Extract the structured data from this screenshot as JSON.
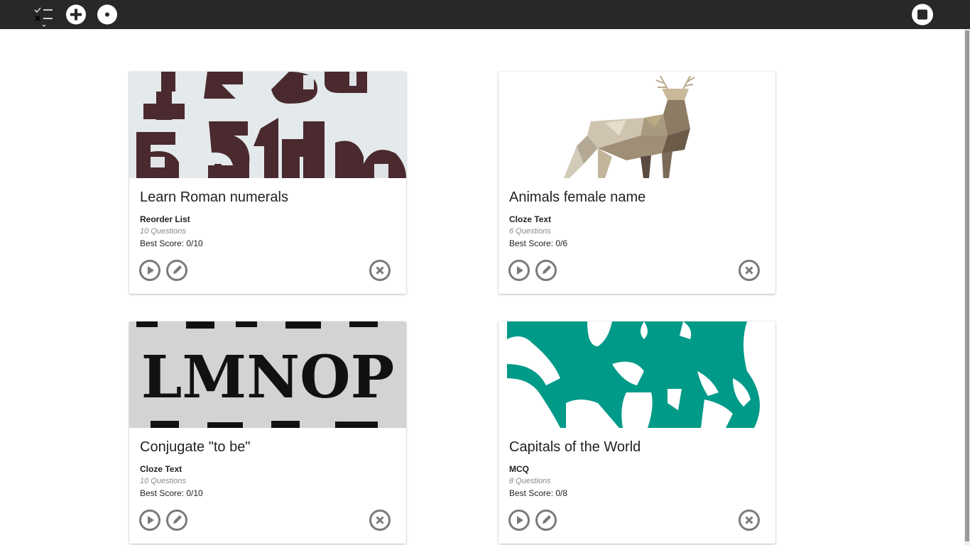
{
  "toolbar": {
    "icons": [
      "check-list-icon",
      "add-icon",
      "target-icon",
      "stop-icon"
    ]
  },
  "cards": [
    {
      "title": "Learn Roman numerals",
      "type": "Reorder List",
      "questions": "10 Questions",
      "score": "Best Score: 0/10",
      "image": "numbers-collage-image"
    },
    {
      "title": "Animals female name",
      "type": "Cloze Text",
      "questions": "6 Questions",
      "score": "Best Score: 0/6",
      "image": "polygon-deer-image"
    },
    {
      "title": "Conjugate \"to be\"",
      "type": "Cloze Text",
      "questions": "10 Questions",
      "score": "Best Score: 0/10",
      "image": "letters-lmnop-image"
    },
    {
      "title": "Capitals of the World",
      "type": "MCQ",
      "questions": "8 Questions",
      "score": "Best Score: 0/8",
      "image": "world-map-image"
    }
  ],
  "colors": {
    "toolbar": "#282828",
    "icon_gray": "#7a7a7a",
    "map_teal": "#009a88"
  }
}
